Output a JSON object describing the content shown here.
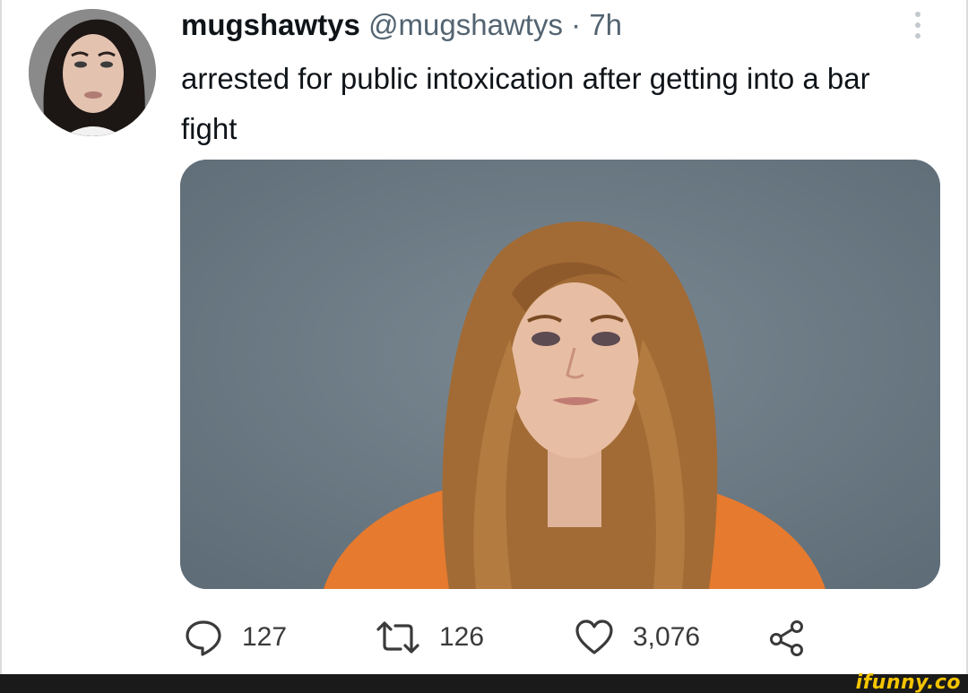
{
  "tweet": {
    "display_name": "mugshawtys",
    "handle": "@mugshawtys",
    "separator": "·",
    "time": "7h",
    "text": "arrested for public intoxication after getting into a bar fight",
    "avatar_alt": "avatar",
    "media_alt": "mugshot photo"
  },
  "actions": {
    "reply_count": "127",
    "retweet_count": "126",
    "like_count": "3,076"
  },
  "icons": {
    "reply": "reply-icon",
    "retweet": "retweet-icon",
    "like": "heart-icon",
    "share": "share-icon",
    "more": "more-vertical-icon"
  },
  "colors": {
    "text": "#0f1419",
    "secondary": "#536471",
    "watermark": "#f5c400",
    "footer": "#1a1a1a"
  },
  "watermark": {
    "text": "ifunny.co"
  }
}
